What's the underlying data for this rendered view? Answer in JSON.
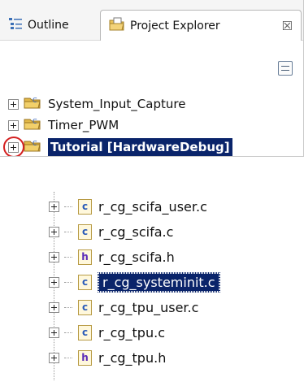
{
  "tabs": {
    "outline_label": "Outline",
    "project_explorer_label": "Project Explorer",
    "close_glyph": "☒"
  },
  "projects": [
    {
      "label": "System_Input_Capture"
    },
    {
      "label": "Timer_PWM"
    },
    {
      "label": "Tutorial [HardwareDebug]"
    }
  ],
  "files": [
    {
      "label": "r_cg_scifa_user.c",
      "type_letter": "c"
    },
    {
      "label": "r_cg_scifa.c",
      "type_letter": "c"
    },
    {
      "label": "r_cg_scifa.h",
      "type_letter": "h"
    },
    {
      "label": "r_cg_systeminit.c",
      "type_letter": "c"
    },
    {
      "label": "r_cg_tpu_user.c",
      "type_letter": "c"
    },
    {
      "label": "r_cg_tpu.c",
      "type_letter": "c"
    },
    {
      "label": "r_cg_tpu.h",
      "type_letter": "h"
    }
  ],
  "colors": {
    "selection_bg": "#0a246a",
    "highlight_circle": "#d42020"
  },
  "icons": {
    "outline": "outline-icon",
    "project_explorer": "project-explorer-icon",
    "collapse_all": "collapse-all-icon",
    "project_folder": "project-folder-icon",
    "c_file": "c-file-icon",
    "h_file": "h-file-icon"
  }
}
